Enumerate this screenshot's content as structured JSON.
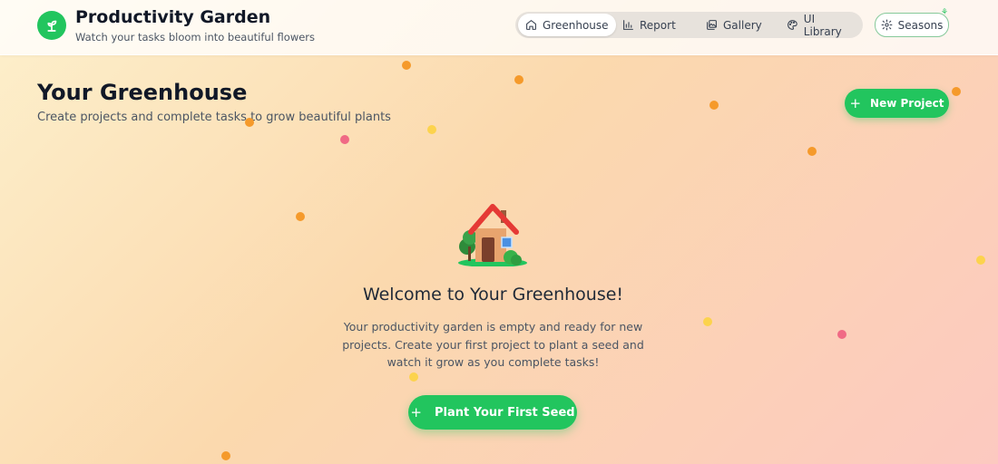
{
  "header": {
    "title": "Productivity Garden",
    "subtitle": "Watch your tasks bloom into beautiful flowers",
    "logo_icon": "sprout-icon",
    "nav": [
      {
        "label": "Greenhouse",
        "icon": "home-icon",
        "active": true
      },
      {
        "label": "Report",
        "icon": "bar-chart-icon",
        "active": false
      },
      {
        "label": "Gallery",
        "icon": "gallery-icon",
        "active": false
      },
      {
        "label": "UI Library",
        "icon": "palette-icon",
        "active": false
      }
    ],
    "seasons_label": "Seasons"
  },
  "page": {
    "title": "Your Greenhouse",
    "subtitle": "Create projects and complete tasks to grow beautiful plants",
    "new_project_label": "New Project"
  },
  "empty_state": {
    "illustration": "house-icon",
    "title": "Welcome to Your Greenhouse!",
    "text": "Your productivity garden is empty and ready for new projects. Create your first project to plant a seed and watch it grow as you complete tasks!",
    "cta_label": "Plant Your First Seed"
  },
  "colors": {
    "accent": "#22c55e",
    "dot_orange": "#f59a2b",
    "dot_yellow": "#fcd34d",
    "dot_pink": "#f06a85"
  }
}
